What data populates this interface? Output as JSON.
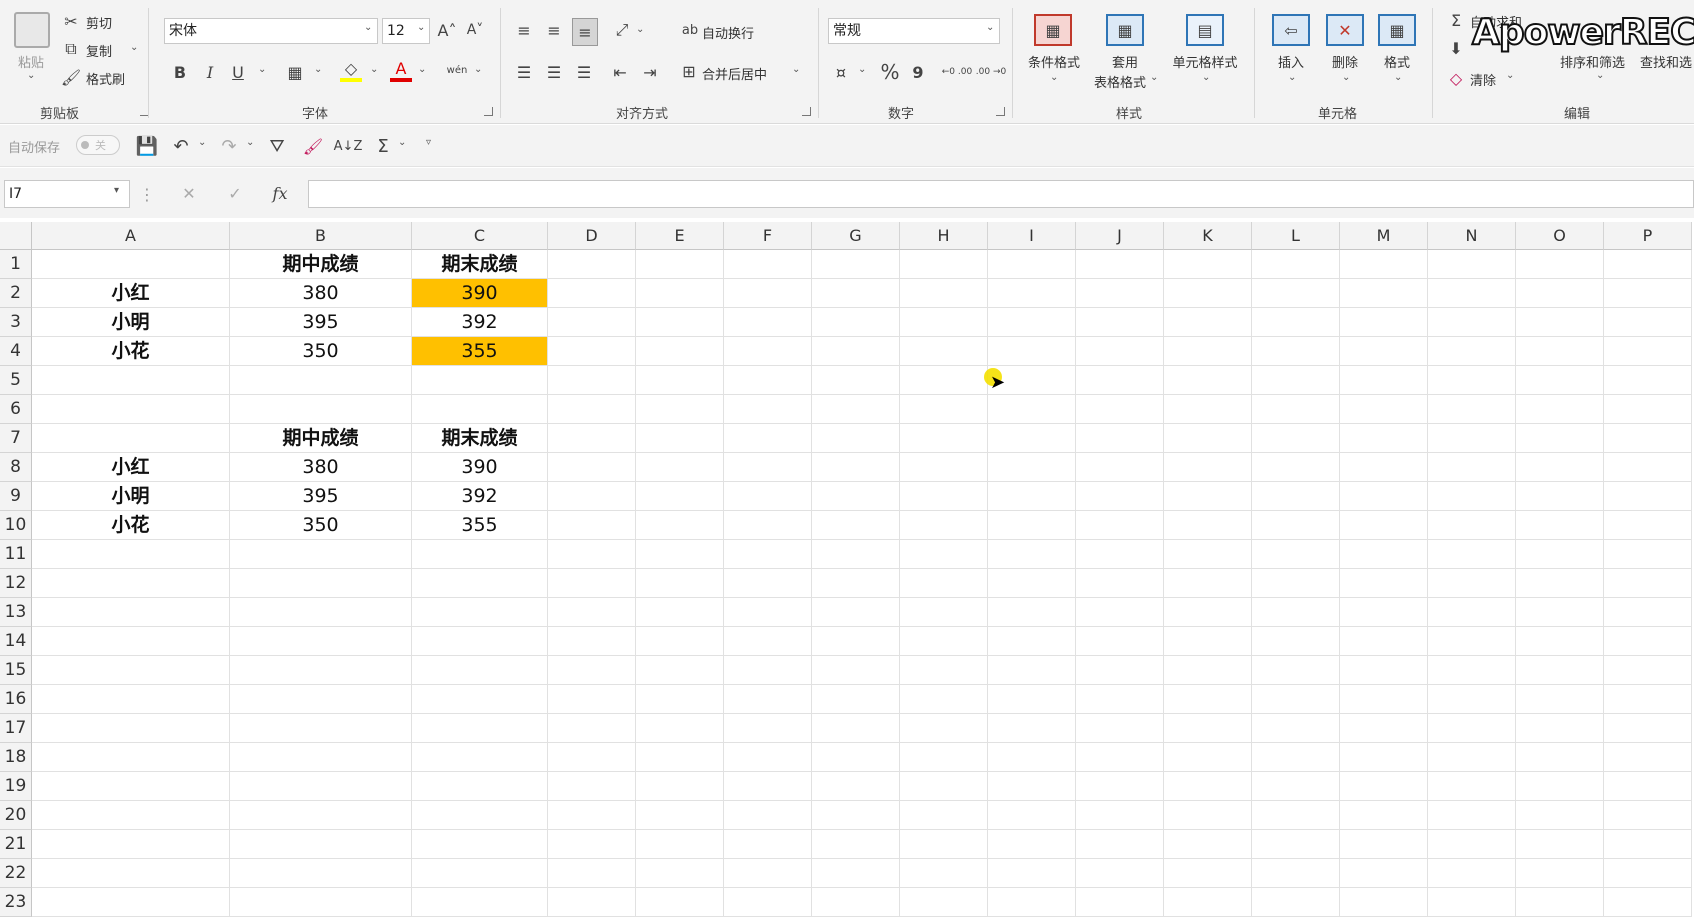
{
  "ribbon": {
    "clipboard": {
      "label": "剪贴板",
      "paste": "粘贴",
      "cut": "剪切",
      "copy": "复制",
      "format_painter": "格式刷"
    },
    "font": {
      "label": "字体",
      "font_name": "宋体",
      "font_size": "12",
      "bold": "B",
      "italic": "I",
      "underline": "U",
      "phonetic": "wén"
    },
    "alignment": {
      "label": "对齐方式",
      "wrap_text": "自动换行",
      "merge_center": "合并后居中"
    },
    "number": {
      "label": "数字",
      "format": "常规",
      "percent": "%",
      "comma": "9",
      "inc_decimal": "←0 .00",
      "dec_decimal": ".00 →0"
    },
    "styles": {
      "label": "样式",
      "conditional": "条件格式",
      "table_format_1": "套用",
      "table_format_2": "表格格式",
      "cell_styles": "单元格样式"
    },
    "cells": {
      "label": "单元格",
      "insert": "插入",
      "delete": "删除",
      "format": "格式"
    },
    "editing": {
      "label": "编辑",
      "autosum": "自动求和",
      "clear": "清除",
      "sort_filter": "排序和筛选",
      "find_select": "查找和选"
    }
  },
  "watermark": "ApowerREC",
  "qat": {
    "autosave": "自动保存",
    "autosave_state": "关"
  },
  "formula_bar": {
    "name_box": "I7",
    "fx": "fx",
    "formula": ""
  },
  "columns": [
    "A",
    "B",
    "C",
    "D",
    "E",
    "F",
    "G",
    "H",
    "I",
    "J",
    "K",
    "L",
    "M",
    "N",
    "O",
    "P"
  ],
  "rows": [
    "1",
    "2",
    "3",
    "4",
    "5",
    "6",
    "7",
    "8",
    "9",
    "10",
    "11",
    "12",
    "13",
    "14",
    "15",
    "16",
    "17",
    "18",
    "19",
    "20",
    "21",
    "22",
    "23"
  ],
  "cells": {
    "B1": "期中成绩",
    "C1": "期末成绩",
    "A2": "小红",
    "B2": "380",
    "C2": "390",
    "A3": "小明",
    "B3": "395",
    "C3": "392",
    "A4": "小花",
    "B4": "350",
    "C4": "355",
    "B7": "期中成绩",
    "C7": "期末成绩",
    "A8": "小红",
    "B8": "380",
    "C8": "390",
    "A9": "小明",
    "B9": "395",
    "C9": "392",
    "A10": "小花",
    "B10": "350",
    "C10": "355"
  },
  "colors": {
    "highlight": "#ffc000",
    "save_icon": "#c2185b",
    "font_color": "#e00000",
    "fill_color": "#ffff00"
  }
}
